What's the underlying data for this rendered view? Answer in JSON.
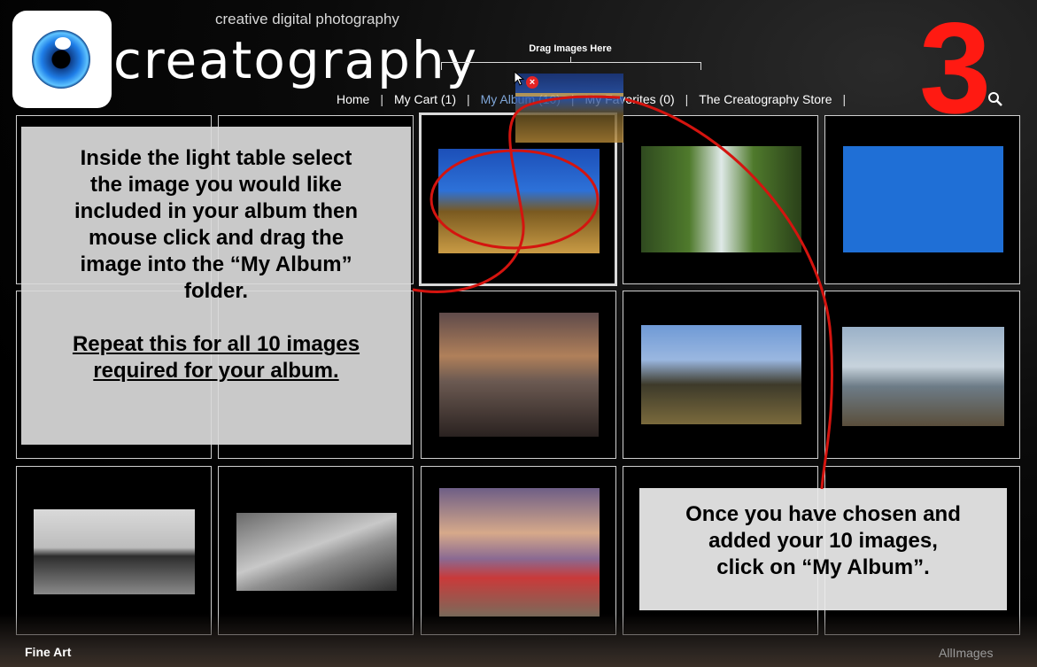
{
  "header": {
    "tagline": "creative digital photography",
    "brand": "creatography",
    "drag_label": "Drag Images Here",
    "step_number": "3"
  },
  "nav": {
    "items": [
      {
        "label": "Home"
      },
      {
        "label": "My Cart (1)"
      },
      {
        "label": "My Album (10)"
      },
      {
        "label": "My Favorites (0)"
      },
      {
        "label": "The Creatography Store"
      }
    ],
    "separator": "|"
  },
  "callouts": {
    "left_line1": "Inside the light table select",
    "left_line2": "the image you would like",
    "left_line3": "included in your album then",
    "left_line4": "mouse click and drag the",
    "left_line5": "image into the “My Album”",
    "left_line6": "folder.",
    "left_line7": "Repeat this for all 10 images",
    "left_line8": "required for your album.",
    "right_line1": "Once you have chosen and",
    "right_line2": "added your 10 images,",
    "right_line3": "click on “My Album”."
  },
  "footer": {
    "left": "Fine Art",
    "right": "AllImages"
  },
  "colors": {
    "accent_red": "#ff1a12",
    "nav_active": "#7fa6d8",
    "callout_bg": "#dadada"
  },
  "icons": [
    "logo-eye-icon",
    "search-icon",
    "cursor-icon",
    "no-drop-icon"
  ]
}
